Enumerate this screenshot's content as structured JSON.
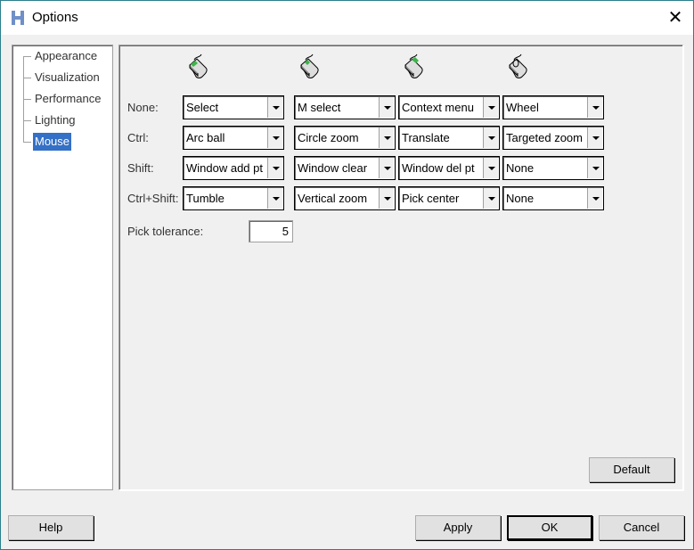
{
  "window": {
    "title": "Options"
  },
  "tree": {
    "items": [
      {
        "label": "Appearance",
        "selected": false
      },
      {
        "label": "Visualization",
        "selected": false
      },
      {
        "label": "Performance",
        "selected": false
      },
      {
        "label": "Lighting",
        "selected": false
      },
      {
        "label": "Mouse",
        "selected": true
      }
    ]
  },
  "mouse": {
    "columns": [
      "left-button",
      "middle-button",
      "right-button",
      "wheel"
    ],
    "rows": [
      {
        "label": "None:",
        "values": [
          "Select",
          "M select",
          "Context menu",
          "Wheel"
        ]
      },
      {
        "label": "Ctrl:",
        "values": [
          "Arc ball",
          "Circle zoom",
          "Translate",
          "Targeted zoom"
        ]
      },
      {
        "label": "Shift:",
        "values": [
          "Window add pt",
          "Window clear",
          "Window del pt",
          "None"
        ]
      },
      {
        "label": "Ctrl+Shift:",
        "values": [
          "Tumble",
          "Vertical zoom",
          "Pick center",
          "None"
        ]
      }
    ],
    "pick_tolerance_label": "Pick tolerance:",
    "pick_tolerance_value": "5",
    "default_label": "Default"
  },
  "buttons": {
    "help": "Help",
    "apply": "Apply",
    "ok": "OK",
    "cancel": "Cancel"
  },
  "colors": {
    "selection": "#3470c6",
    "button_highlight": "#3cb44b"
  }
}
